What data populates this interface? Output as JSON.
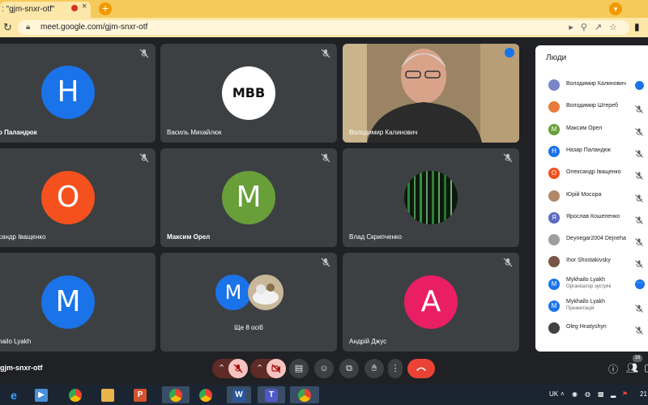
{
  "browser": {
    "tab_title": ": \"gjm-snxr-otf\"",
    "tab_close": "×",
    "new_tab": "+",
    "url": "meet.google.com/gjm-snxr-otf",
    "reload_icon": "reload-icon",
    "lock_icon": "lock-icon"
  },
  "tiles": [
    {
      "name": "о Паландюк",
      "initial": "Н",
      "color": "#1a73e8",
      "bold": true
    },
    {
      "name": "Василь Михайлюк",
      "initial": "MBB",
      "color": "#ffffff"
    },
    {
      "name": "Володимир Калинович",
      "speaking": true
    },
    {
      "name": "сандр Іващенко",
      "initial": "О",
      "color": "#f4511e"
    },
    {
      "name": "Максим Орел",
      "initial": "М",
      "color": "#689f38",
      "bold": true
    },
    {
      "name": "Влад Скрипченко"
    },
    {
      "name": "hailo Lyakh",
      "initial": "M",
      "color": "#1a73e8"
    },
    {
      "name": "Ще 8 осіб",
      "initial": "М",
      "color": "#1a73e8"
    },
    {
      "name": "Андрій Джус",
      "initial": "А",
      "color": "#e91e63"
    }
  ],
  "panel": {
    "title": "Люди",
    "people": [
      {
        "name": "Володимир Калинович",
        "initial": "",
        "color": "#7986cb",
        "status": "speaking"
      },
      {
        "name": "Володимир Штереб",
        "initial": "",
        "color": "#e67c3b",
        "status": "muted"
      },
      {
        "name": "Максим Орел",
        "initial": "М",
        "color": "#689f38",
        "status": "muted"
      },
      {
        "name": "Назар Паландюк",
        "initial": "Н",
        "color": "#1a73e8",
        "status": "muted"
      },
      {
        "name": "Олександр Іващенко",
        "initial": "О",
        "color": "#f4511e",
        "status": "muted"
      },
      {
        "name": "Юрій Мосора",
        "initial": "",
        "color": "#b08968",
        "status": "muted"
      },
      {
        "name": "Ярослав Кошеленко",
        "initial": "Я",
        "color": "#5c6bc0",
        "status": "muted"
      },
      {
        "name": "Deynegar2004 Dejneha",
        "initial": "",
        "color": "#9e9e9e",
        "status": "muted"
      },
      {
        "name": "Ihor Shostakivsky",
        "initial": "",
        "color": "#795548",
        "status": "muted"
      },
      {
        "name": "Mykhailo Lyakh",
        "sub": "Організатор зустрічі",
        "initial": "M",
        "color": "#1a73e8",
        "status": "more"
      },
      {
        "name": "Mykhailo Lyakh",
        "sub": "Презентація",
        "initial": "M",
        "color": "#1a73e8",
        "status": "muted"
      },
      {
        "name": "Oleg Hnatyshyn",
        "initial": "",
        "color": "#424242",
        "status": "muted"
      }
    ]
  },
  "controls": {
    "meeting_code": "gjm-snxr-otf",
    "participants_count": "16"
  },
  "taskbar": {
    "lang": "UK",
    "clock": "21"
  }
}
